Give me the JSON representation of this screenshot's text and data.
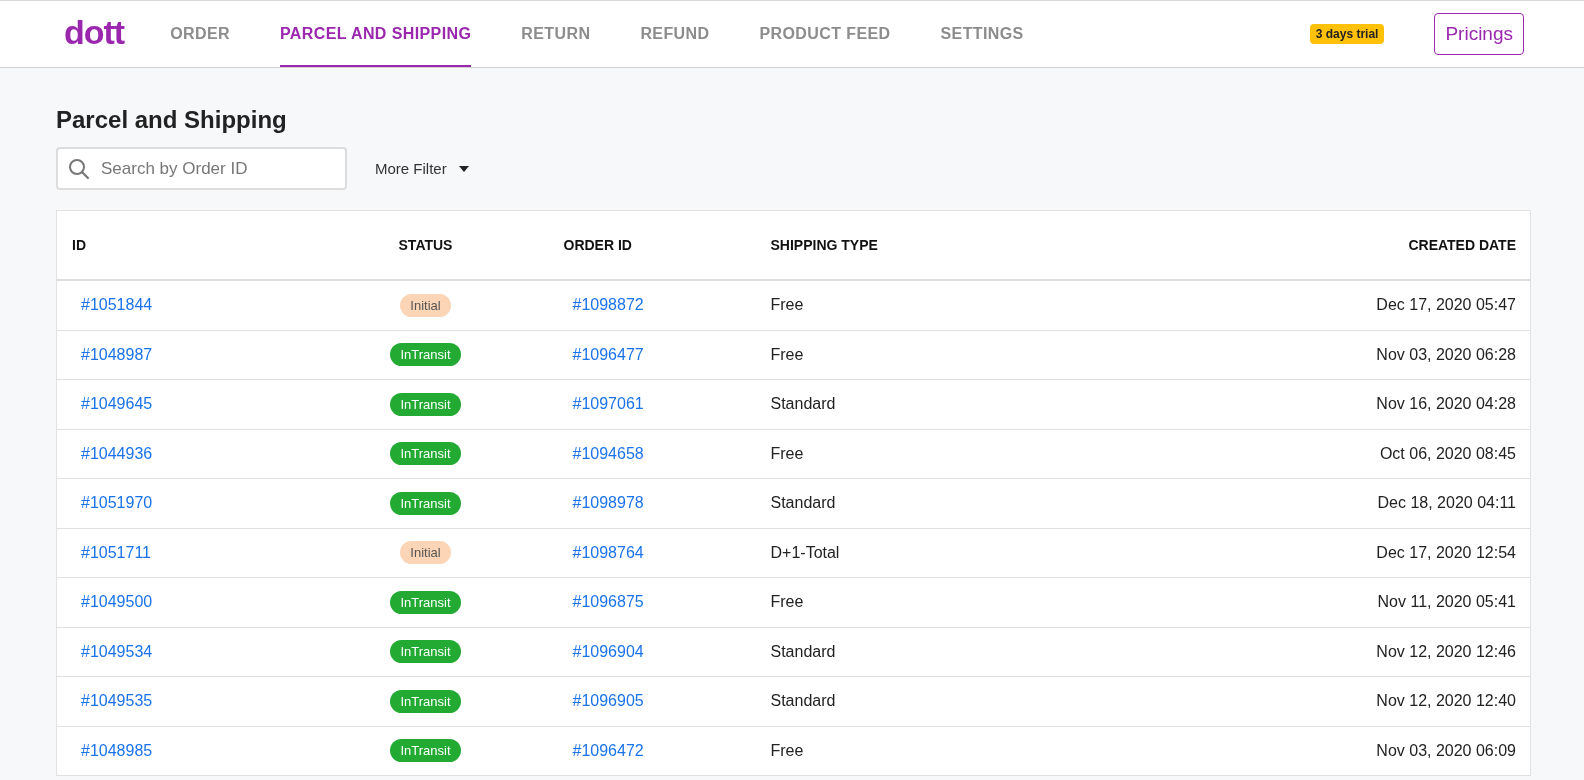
{
  "nav": {
    "logo": "dott",
    "tabs": [
      {
        "label": "ORDER",
        "selected": false
      },
      {
        "label": "PARCEL AND SHIPPING",
        "selected": true
      },
      {
        "label": "RETURN",
        "selected": false
      },
      {
        "label": "REFUND",
        "selected": false
      },
      {
        "label": "PRODUCT FEED",
        "selected": false
      },
      {
        "label": "SETTINGS",
        "selected": false
      }
    ],
    "trial_badge": "3 days trial",
    "pricing_button": "Pricings"
  },
  "page": {
    "title": "Parcel and Shipping",
    "search": {
      "placeholder": "Search by Order ID"
    },
    "filter_button": "More Filter"
  },
  "table": {
    "columns": [
      "ID",
      "STATUS",
      "ORDER ID",
      "SHIPPING TYPE",
      "CREATED DATE"
    ],
    "rows": [
      {
        "id": "#1051844",
        "status": {
          "label": "Initial",
          "kind": "initial"
        },
        "order_id": "#1098872",
        "shipping_type": "Free",
        "created": "Dec 17, 2020 05:47"
      },
      {
        "id": "#1048987",
        "status": {
          "label": "InTransit",
          "kind": "intransit"
        },
        "order_id": "#1096477",
        "shipping_type": "Free",
        "created": "Nov 03, 2020 06:28"
      },
      {
        "id": "#1049645",
        "status": {
          "label": "InTransit",
          "kind": "intransit"
        },
        "order_id": "#1097061",
        "shipping_type": "Standard",
        "created": "Nov 16, 2020 04:28"
      },
      {
        "id": "#1044936",
        "status": {
          "label": "InTransit",
          "kind": "intransit"
        },
        "order_id": "#1094658",
        "shipping_type": "Free",
        "created": "Oct 06, 2020 08:45"
      },
      {
        "id": "#1051970",
        "status": {
          "label": "InTransit",
          "kind": "intransit"
        },
        "order_id": "#1098978",
        "shipping_type": "Standard",
        "created": "Dec 18, 2020 04:11"
      },
      {
        "id": "#1051711",
        "status": {
          "label": "Initial",
          "kind": "initial"
        },
        "order_id": "#1098764",
        "shipping_type": "D+1-Total",
        "created": "Dec 17, 2020 12:54"
      },
      {
        "id": "#1049500",
        "status": {
          "label": "InTransit",
          "kind": "intransit"
        },
        "order_id": "#1096875",
        "shipping_type": "Free",
        "created": "Nov 11, 2020 05:41"
      },
      {
        "id": "#1049534",
        "status": {
          "label": "InTransit",
          "kind": "intransit"
        },
        "order_id": "#1096904",
        "shipping_type": "Standard",
        "created": "Nov 12, 2020 12:46"
      },
      {
        "id": "#1049535",
        "status": {
          "label": "InTransit",
          "kind": "intransit"
        },
        "order_id": "#1096905",
        "shipping_type": "Standard",
        "created": "Nov 12, 2020 12:40"
      },
      {
        "id": "#1048985",
        "status": {
          "label": "InTransit",
          "kind": "intransit"
        },
        "order_id": "#1096472",
        "shipping_type": "Free",
        "created": "Nov 03, 2020 06:09"
      }
    ]
  }
}
